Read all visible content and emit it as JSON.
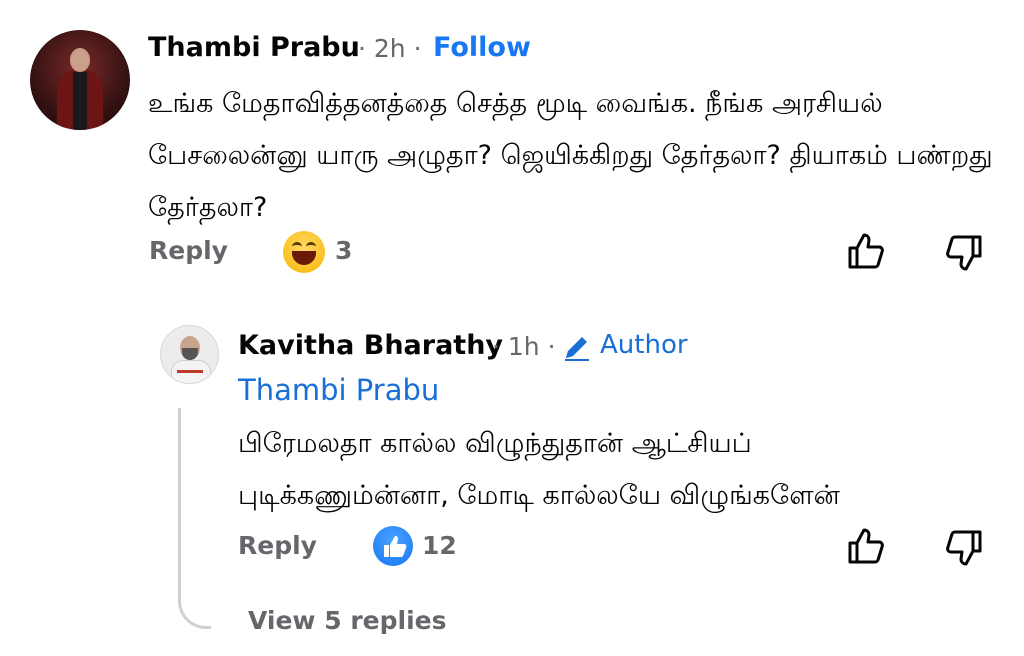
{
  "comment": {
    "author": "Thambi Prabu",
    "separator": "·",
    "time": "2h",
    "follow_label": "Follow",
    "text": "உங்க மேதாவித்தனத்தை செத்த மூடி வைங்க. நீங்க அரசியல் பேசலைன்னு யாரு அழுதா? ஜெயிக்கிறது தேர்தலா? தியாகம் பண்றது தேர்தலா?",
    "reply_label": "Reply",
    "reaction_icon": "laughing-emoji-icon",
    "reaction_count": "3"
  },
  "reply": {
    "author": "Kavitha Bharathy",
    "separator": "·",
    "time": "1h",
    "author_badge_icon": "pencil-icon",
    "author_badge_label": "Author",
    "mention": "Thambi Prabu",
    "text": "பிரேமலதா கால்ல விழுந்துதான் ஆட்சியப் புடிக்கணும்ன்னா, மோடி கால்லயே விழுங்களேன்",
    "reply_label": "Reply",
    "reaction_icon": "like-icon",
    "reaction_count": "12"
  },
  "view_replies_label": "View 5 replies",
  "colors": {
    "accent_blue": "#1877f2",
    "secondary_text": "#65676b",
    "primary_text": "#050505"
  }
}
